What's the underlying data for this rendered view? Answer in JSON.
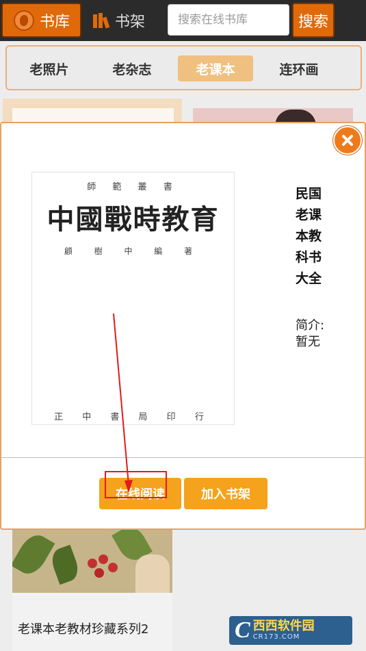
{
  "header": {
    "library_tab": "书库",
    "shelf_tab": "书架",
    "search_placeholder": "搜索在线书库",
    "search_button": "搜索"
  },
  "categories": [
    {
      "label": "老照片",
      "active": false
    },
    {
      "label": "老杂志",
      "active": false
    },
    {
      "label": "老课本",
      "active": true
    },
    {
      "label": "连环画",
      "active": false
    }
  ],
  "modal": {
    "cover": {
      "top_line": "師 範 叢 書",
      "title": "中國戰時教育",
      "author_line": "顧 樹 中 編 著",
      "publisher": "正 中 書 局 印 行"
    },
    "title": "民国老课本教科书大全",
    "description": "简介:暂无",
    "read_button": "在线阅读",
    "add_button": "加入书架"
  },
  "background": {
    "bottom_caption": "老课本老教材珍藏系列2"
  },
  "watermark": {
    "letter": "C",
    "main": "西西软件园",
    "sub": "CR173.COM"
  },
  "colors": {
    "accent": "#e06a0a",
    "button": "#f5a21d",
    "annotation": "#e21a1a"
  }
}
